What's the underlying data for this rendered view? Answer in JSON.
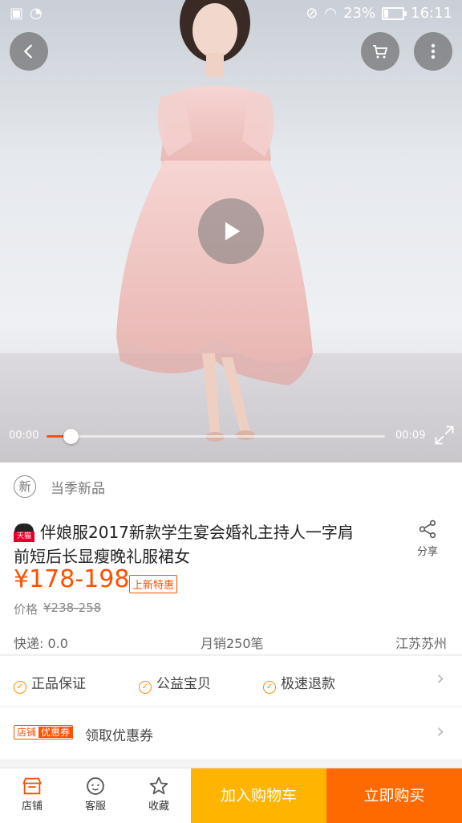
{
  "status_bar": {
    "battery": "23%",
    "battery_level": 0.23,
    "time": "16:11"
  },
  "video": {
    "current_time": "00:00",
    "duration": "00:09",
    "progress": 0.07
  },
  "badge": {
    "icon_text": "新",
    "label": "当季新品"
  },
  "product": {
    "store_badge": "天猫",
    "title_line1": "伴娘服2017新款学生宴会婚礼主持人一字肩",
    "title_line2": "前短后长显瘦晚礼服裙女",
    "share_label": "分享",
    "price": "¥178-198",
    "promo_tag": "上新特惠",
    "original_price_label": "价格",
    "original_price": "¥238-258",
    "shipping": "快递: 0.0",
    "monthly_sales": "月销250笔",
    "location": "江苏苏州"
  },
  "services": [
    "正品保证",
    "公益宝贝",
    "极速退款"
  ],
  "coupon": {
    "tag_store": "店铺",
    "tag_coupon": "优惠券",
    "label": "领取优惠券"
  },
  "bottom_bar": {
    "store_label": "店铺",
    "service_label": "客服",
    "favorite_label": "收藏",
    "add_to_cart_label": "加入购物车",
    "buy_now_label": "立即购买"
  },
  "colors": {
    "accent": "#ff5000",
    "cart_button": "#ffb400",
    "buy_button": "#ff6a00"
  }
}
